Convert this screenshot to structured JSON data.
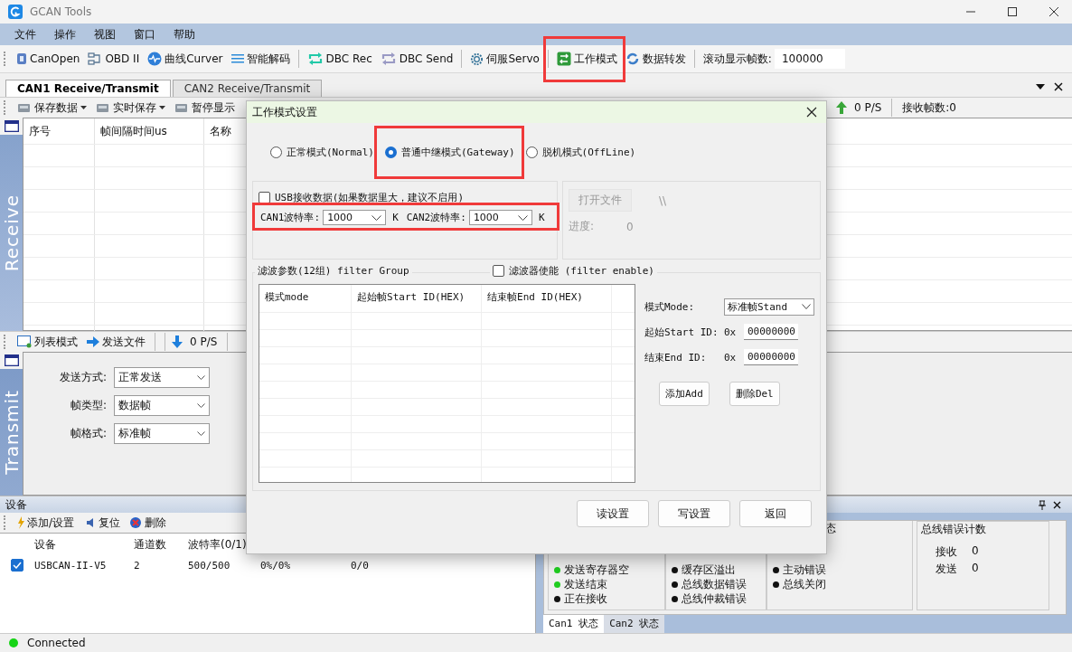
{
  "window": {
    "title": "GCAN Tools"
  },
  "menu": [
    "文件",
    "操作",
    "视图",
    "窗口",
    "帮助"
  ],
  "toolbar": {
    "items": [
      {
        "label": "CanOpen",
        "highlighted": false
      },
      {
        "label": "OBD II",
        "highlighted": false
      },
      {
        "label": "曲线Curver",
        "highlighted": false
      },
      {
        "label": "智能解码",
        "highlighted": false
      },
      {
        "label": "DBC Rec",
        "highlighted": false
      },
      {
        "label": "DBC Send",
        "highlighted": false
      },
      {
        "label": "伺服Servo",
        "highlighted": false
      },
      {
        "label": "工作模式",
        "highlighted": true
      },
      {
        "label": "数据转发",
        "highlighted": false
      }
    ],
    "frame_count_label": "滚动显示帧数:",
    "frame_count_value": "100000"
  },
  "tabs": [
    {
      "label": "CAN1 Receive/Transmit",
      "selected": true
    },
    {
      "label": "CAN2 Receive/Transmit",
      "selected": false
    }
  ],
  "receive_toolbar": {
    "items": [
      {
        "label": "保存数据",
        "dropdown": true
      },
      {
        "label": "实时保存",
        "dropdown": true
      },
      {
        "label": "暂停显示",
        "dropdown": false
      }
    ],
    "rate": "0 P/S",
    "count": "接收帧数:0"
  },
  "receive": {
    "side_label": "Receive",
    "columns": [
      "序号",
      "帧间隔时间us",
      "名称"
    ]
  },
  "transmit_toolbar": {
    "items": [
      "列表模式",
      "发送文件"
    ],
    "rate": "0 P/S"
  },
  "transmit": {
    "side_label": "Transmit",
    "fields": [
      {
        "label": "发送方式:",
        "value": "正常发送"
      },
      {
        "label": "帧类型:",
        "value": "数据帧"
      },
      {
        "label": "帧格式:",
        "value": "标准帧"
      }
    ]
  },
  "device_panel": {
    "title": "设备",
    "toolbar": [
      "添加/设置",
      "复位",
      "删除"
    ],
    "columns": [
      "设备",
      "通道数",
      "波特率(0/1)"
    ],
    "rows": [
      {
        "checked": true,
        "cells": [
          "USBCAN-II-V5",
          "2",
          "500/500",
          "0%/0%",
          "0/0"
        ]
      }
    ]
  },
  "status_panel": {
    "groups": [
      {
        "lines": [
          {
            "label": "发送寄存器空",
            "color": "#1fcc1f"
          },
          {
            "label": "发送结束",
            "color": "#1fcc1f"
          },
          {
            "label": "正在接收",
            "color": "#111111"
          }
        ]
      },
      {
        "lines": [
          {
            "label": "缓存区溢出",
            "color": "#111111"
          },
          {
            "label": "总线数据错误",
            "color": "#111111"
          },
          {
            "label": "总线仲裁错误",
            "color": "#111111"
          }
        ]
      },
      {
        "title": "态",
        "lines": [
          {
            "label": "主动错误",
            "color": "#111111"
          },
          {
            "label": "总线关闭",
            "color": "#111111"
          }
        ]
      }
    ],
    "error_counter": {
      "title": "总线错误计数",
      "rows": [
        {
          "label": "接收",
          "value": "0"
        },
        {
          "label": "发送",
          "value": "0"
        }
      ]
    },
    "tabs": [
      {
        "label": "Can1 状态",
        "selected": true
      },
      {
        "label": "Can2 状态",
        "selected": false
      }
    ]
  },
  "status_bar": {
    "text": "Connected",
    "connected": true
  },
  "dialog": {
    "title": "工作模式设置",
    "modes": [
      {
        "label": "正常模式(Normal)",
        "selected": false,
        "highlighted": false
      },
      {
        "label": "普通中继模式(Gateway)",
        "selected": true,
        "highlighted": true
      },
      {
        "label": "脱机模式(OffLine)",
        "selected": false,
        "highlighted": false
      }
    ],
    "usb_receive": {
      "label": "USB接收数据(如果数据里大，建议不启用)",
      "checked": false
    },
    "baud_rates": {
      "highlighted": true,
      "items": [
        {
          "label": "CAN1波特率:",
          "value": "1000",
          "unit": "K"
        },
        {
          "label": "CAN2波特率:",
          "value": "1000",
          "unit": "K"
        }
      ]
    },
    "file": {
      "button": "打开文件",
      "path": "\\\\",
      "progress_label": "进度:",
      "progress_value": "0",
      "disabled": true
    },
    "filter": {
      "title": "滤波参数(12组) filter Group",
      "enable": {
        "label": "滤波器使能 (filter enable)",
        "checked": false
      },
      "columns": [
        "模式mode",
        "起始帧Start ID(HEX)",
        "结束帧End ID(HEX)"
      ],
      "mode_label": "模式Mode:",
      "mode_value": "标准帧Stand",
      "start_label": "起始Start ID:",
      "start_prefix": "0x",
      "start_value": "00000000",
      "end_label": "结束End ID:",
      "end_prefix": "0x",
      "end_value": "00000000",
      "buttons": [
        "添加Add",
        "删除Del"
      ]
    },
    "buttons": [
      "读设置",
      "写设置",
      "返回"
    ]
  }
}
